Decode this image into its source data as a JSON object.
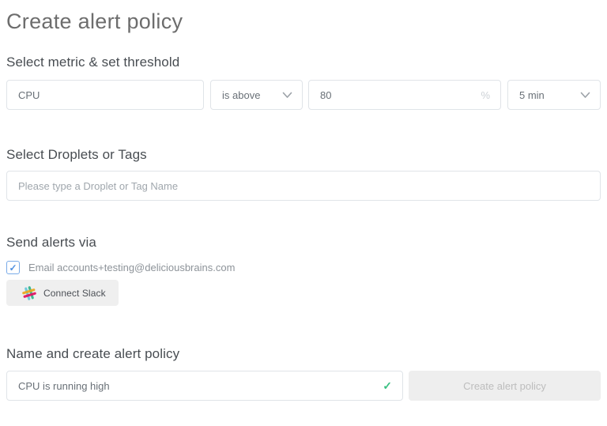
{
  "page": {
    "title": "Create alert policy"
  },
  "threshold_section": {
    "heading": "Select metric & set threshold",
    "metric_input": {
      "value": "CPU"
    },
    "comparator_select": {
      "value": "is above"
    },
    "threshold_input": {
      "value": "80",
      "suffix": "%"
    },
    "duration_select": {
      "value": "5 min"
    }
  },
  "droplets_section": {
    "heading": "Select Droplets or Tags",
    "search_input": {
      "placeholder": "Please type a Droplet or Tag Name"
    }
  },
  "alerts_section": {
    "heading": "Send alerts via",
    "email_checkbox": {
      "checked": true,
      "label": "Email accounts+testing@deliciousbrains.com"
    },
    "slack_button": {
      "label": "Connect Slack"
    }
  },
  "name_section": {
    "heading": "Name and create alert policy",
    "name_input": {
      "value": "CPU is running high",
      "valid": true
    },
    "create_button": {
      "label": "Create alert policy",
      "disabled": true
    }
  },
  "icons": {
    "check": "✓"
  },
  "colors": {
    "checkbox_blue": "#4f90e0",
    "valid_green": "#3ac082",
    "disabled_button_bg": "#eeeeee",
    "slack_blue": "#6ECADC",
    "slack_green": "#3EB991",
    "slack_yellow": "#E9A820",
    "slack_pink": "#E01563"
  }
}
